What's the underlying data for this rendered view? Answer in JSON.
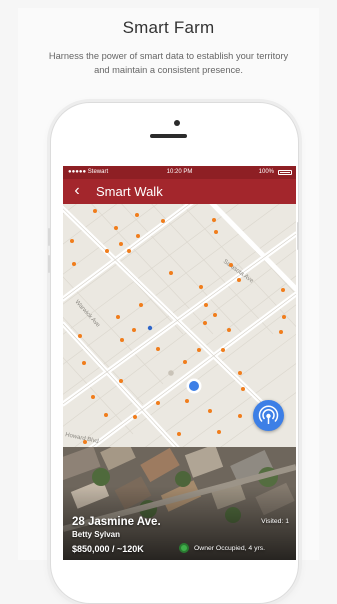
{
  "header": {
    "title": "Smart Farm",
    "subtitle": "Harness the power of smart data to establish your territory and maintain a consistent presence."
  },
  "status_bar": {
    "carrier": "●●●●● Stewart",
    "time": "10:20 PM",
    "battery": "100%"
  },
  "nav": {
    "back_icon": "‹",
    "title": "Smart Walk"
  },
  "map": {
    "street_labels": [
      "Sarasota Ave",
      "Warwick Ave",
      "Howard Blvd"
    ],
    "locate_icon": "broadcast-icon"
  },
  "property_card": {
    "address": "28 Jasmine Ave.",
    "owner_name": "Betty Sylvan",
    "price": "$850,000 / ~120K",
    "visited": "Visited: 1",
    "occupancy": "Owner Occupied, 4 yrs."
  },
  "colors": {
    "brand_red": "#a3262c",
    "status_red": "#8e1f24",
    "pin_orange": "#f07d1c",
    "accent_blue": "#3d7fe6"
  }
}
